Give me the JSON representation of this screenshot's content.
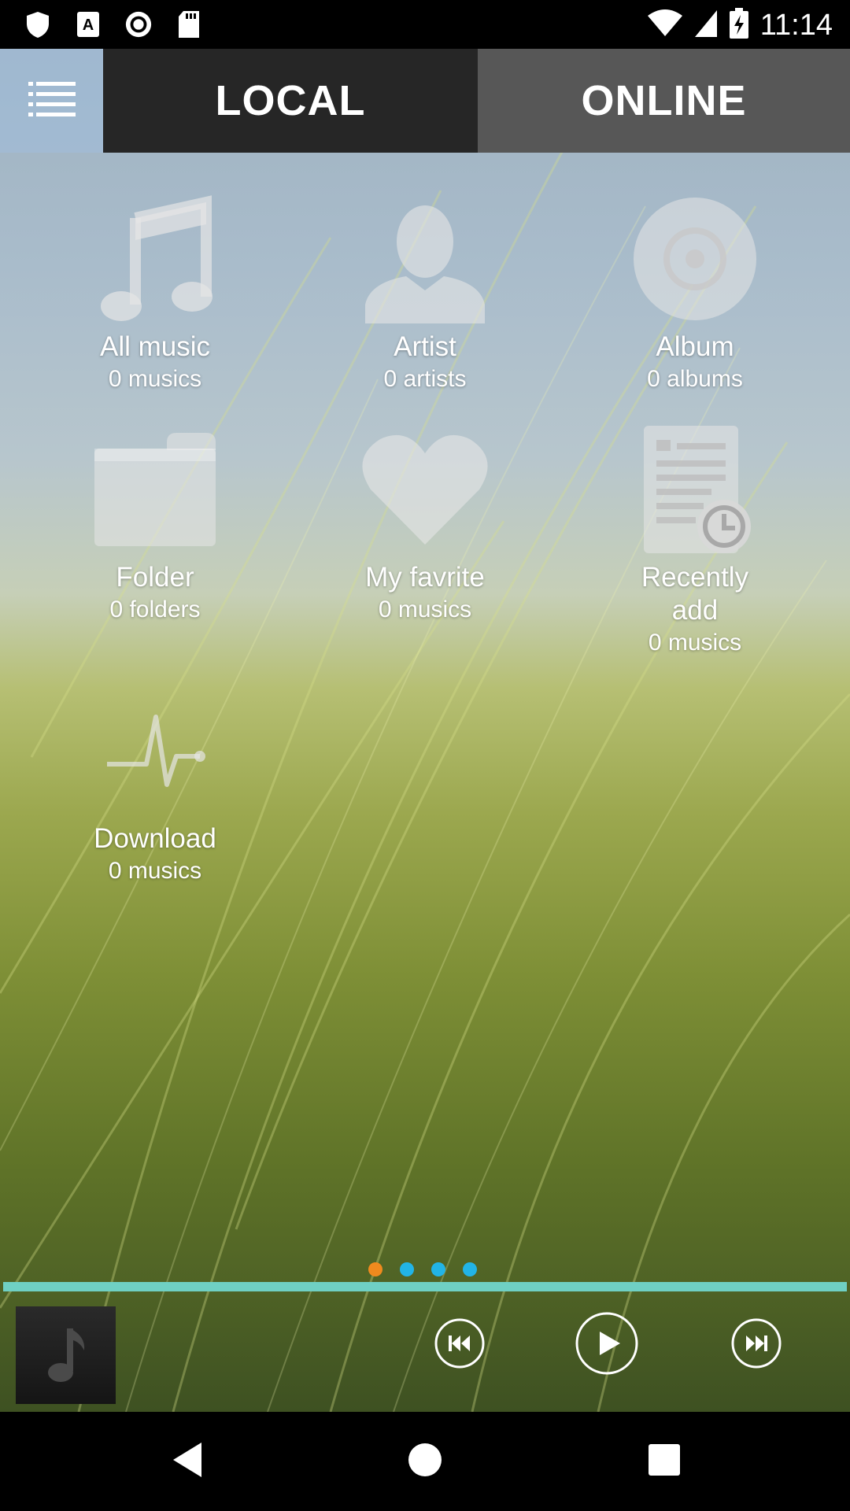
{
  "status_bar": {
    "time": "11:14"
  },
  "tabs": [
    {
      "label": "LOCAL",
      "selected": true
    },
    {
      "label": "ONLINE",
      "selected": false
    }
  ],
  "categories": [
    {
      "name": "All music",
      "count": "0 musics",
      "icon": "music-note-icon"
    },
    {
      "name": "Artist",
      "count": "0 artists",
      "icon": "person-icon"
    },
    {
      "name": "Album",
      "count": "0 albums",
      "icon": "disc-icon"
    },
    {
      "name": "Folder",
      "count": "0 folders",
      "icon": "folder-icon"
    },
    {
      "name": "My favrite",
      "count": "0 musics",
      "icon": "heart-icon"
    },
    {
      "name": "Recently add",
      "count": "0 musics",
      "icon": "recent-document-icon"
    },
    {
      "name": "Download",
      "count": "0 musics",
      "icon": "pulse-icon"
    }
  ],
  "pager": {
    "count": 4,
    "active_index": 0
  },
  "player": {
    "progress": 1.0
  },
  "colors": {
    "progress": "#6fd0c4",
    "dot_active": "#f08a1e",
    "dot_inactive": "#22b4e6"
  }
}
